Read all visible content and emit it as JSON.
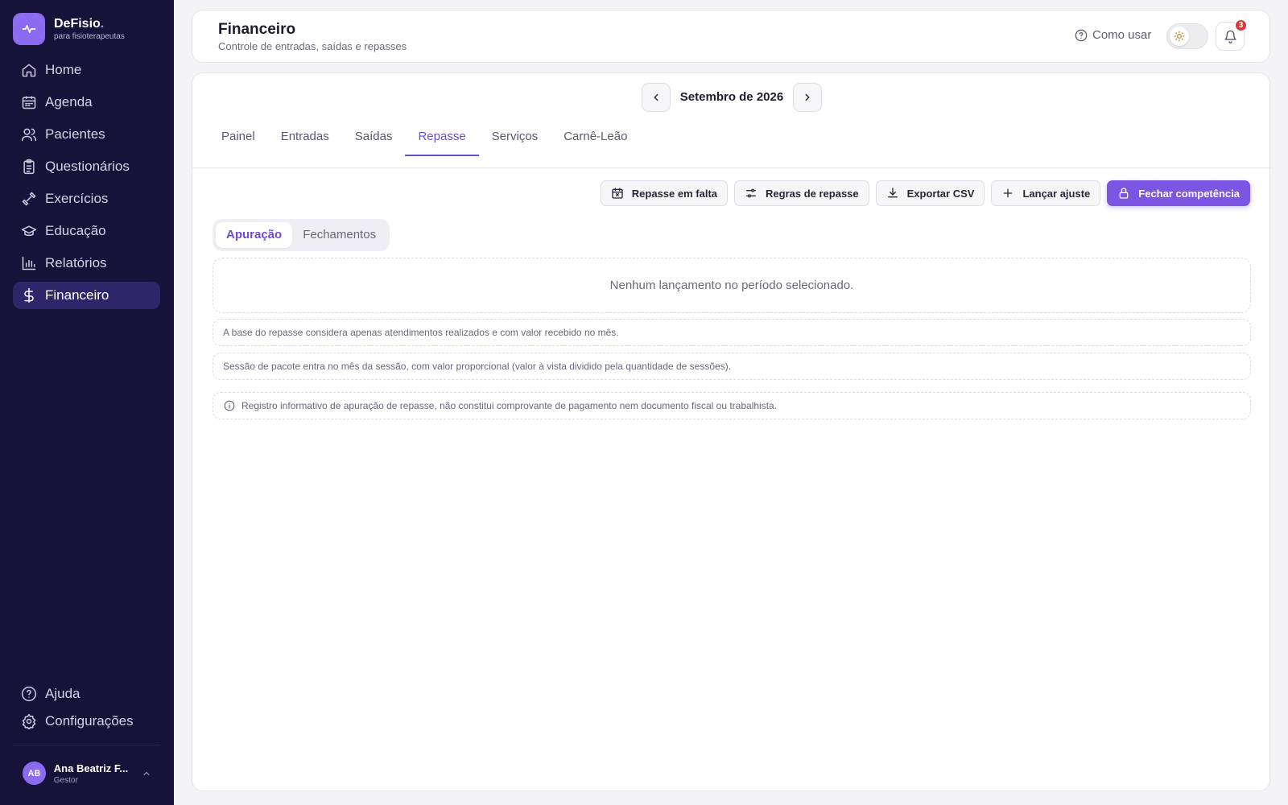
{
  "brand": {
    "name": "DeFisio",
    "dot": ".",
    "subtitle": "para fisioterapeutas"
  },
  "sidebar": {
    "items": [
      {
        "label": "Home",
        "icon": "home-icon"
      },
      {
        "label": "Agenda",
        "icon": "calendar-icon"
      },
      {
        "label": "Pacientes",
        "icon": "users-icon"
      },
      {
        "label": "Questionários",
        "icon": "clipboard-icon"
      },
      {
        "label": "Exercícios",
        "icon": "dumbbell-icon"
      },
      {
        "label": "Educação",
        "icon": "graduation-cap-icon"
      },
      {
        "label": "Relatórios",
        "icon": "bar-chart-icon"
      },
      {
        "label": "Financeiro",
        "icon": "dollar-icon",
        "active": true
      }
    ],
    "bottom": [
      {
        "label": "Ajuda",
        "icon": "help-circle-icon"
      },
      {
        "label": "Configurações",
        "icon": "gear-icon"
      }
    ],
    "user": {
      "initials": "AB",
      "name": "Ana Beatriz F...",
      "role": "Gestor"
    }
  },
  "header": {
    "title": "Financeiro",
    "subtitle": "Controle de entradas, saídas e repasses",
    "help_label": "Como usar",
    "notification_count": "3"
  },
  "main": {
    "month": "Setembro de 2026",
    "tabs": [
      "Painel",
      "Entradas",
      "Saídas",
      "Repasse",
      "Serviços",
      "Carnê-Leão"
    ],
    "active_tab": "Repasse",
    "actions": [
      {
        "label": "Repasse em falta",
        "icon": "calendar-x-icon"
      },
      {
        "label": "Regras de repasse",
        "icon": "sliders-icon"
      },
      {
        "label": "Exportar CSV",
        "icon": "download-icon"
      },
      {
        "label": "Lançar ajuste",
        "icon": "plus-icon"
      },
      {
        "label": "Fechar competência",
        "icon": "lock-icon",
        "primary": true
      }
    ],
    "segments": [
      "Apuração",
      "Fechamentos"
    ],
    "active_segment": "Apuração",
    "empty_message": "Nenhum lançamento no período selecionado.",
    "notes": [
      "A base do repasse considera apenas atendimentos realizados e com valor recebido no mês.",
      "Sessão de pacote entra no mês da sessão, com valor proporcional (valor à vista dividido pela quantidade de sessões)."
    ],
    "disclaimer": "Registro informativo de apuração de repasse, não constitui comprovante de pagamento nem documento fiscal ou trabalhista."
  },
  "colors": {
    "sidebar_bg": "#17123a",
    "accent": "#7c55e2",
    "active_nav_bg": "#2e2669",
    "badge": "#d63a3a"
  }
}
